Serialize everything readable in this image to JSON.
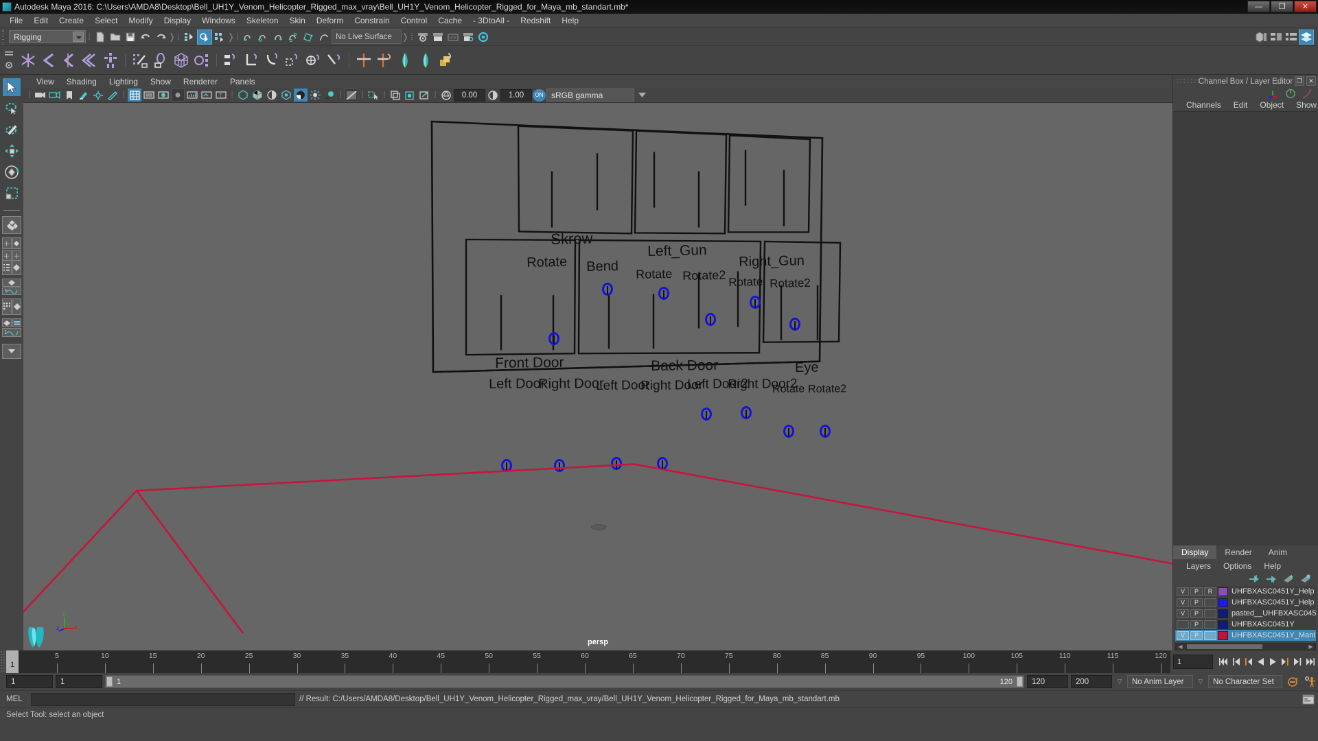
{
  "window": {
    "title": "Autodesk Maya 2016: C:\\Users\\AMDA8\\Desktop\\Bell_UH1Y_Venom_Helicopter_Rigged_max_vray\\Bell_UH1Y_Venom_Helicopter_Rigged_for_Maya_mb_standart.mb*",
    "minimize": "—",
    "maximize": "❐",
    "close": "✕"
  },
  "menubar": {
    "items": [
      "File",
      "Edit",
      "Create",
      "Select",
      "Modify",
      "Display",
      "Windows",
      "Skeleton",
      "Skin",
      "Deform",
      "Constrain",
      "Control",
      "Cache",
      "- 3DtoAll -",
      "Redshift",
      "Help"
    ]
  },
  "statusline": {
    "menuset": "Rigging",
    "live_surface": "No Live Surface"
  },
  "viewport_menu": {
    "items": [
      "View",
      "Shading",
      "Lighting",
      "Show",
      "Renderer",
      "Panels"
    ]
  },
  "viewport_toolbar": {
    "exposure": "0.00",
    "gamma": "1.00",
    "on_badge": "ON",
    "color_profile": "sRGB gamma"
  },
  "viewport": {
    "camera_label": "persp",
    "axis_x": "x",
    "axis_y": "y",
    "axis_z": "z"
  },
  "control_panel": {
    "groups": [
      {
        "title": "Skrew",
        "labels": [
          "Rotate",
          "Bend"
        ]
      },
      {
        "title": "Left_Gun",
        "labels": [
          "Rotate",
          "Rotate2"
        ]
      },
      {
        "title": "Right_Gun",
        "labels": [
          "Rotate",
          "Rotate2"
        ]
      },
      {
        "title": "Front Door",
        "labels": [
          "Left Door",
          "Right Door"
        ]
      },
      {
        "title": "Back Door",
        "labels": [
          "Left Door",
          "Right Door",
          "Left Door2",
          "Right Door2"
        ]
      },
      {
        "title": "Eye",
        "labels": [
          "Rotate",
          "Rotate2"
        ]
      }
    ]
  },
  "channel_box": {
    "panel_title": "Channel Box / Layer Editor",
    "menus": [
      "Channels",
      "Edit",
      "Object",
      "Show"
    ]
  },
  "layer_editor": {
    "tabs": [
      "Display",
      "Render",
      "Anim"
    ],
    "menus": [
      "Layers",
      "Options",
      "Help"
    ],
    "layers": [
      {
        "v": "V",
        "p": "P",
        "r": "R",
        "color": "#8a4fb5",
        "name": "UHFBXASC0451Y_Help",
        "selected": false
      },
      {
        "v": "V",
        "p": "P",
        "r": "",
        "color": "#1b1bf0",
        "name": "UHFBXASC0451Y_Help",
        "selected": false
      },
      {
        "v": "V",
        "p": "P",
        "r": "",
        "color": "#101a7e",
        "name": "pasted__UHFBXASC045",
        "selected": false
      },
      {
        "v": "",
        "p": "P",
        "r": "",
        "color": "#101a7e",
        "name": "UHFBXASC0451Y",
        "selected": false
      },
      {
        "v": "V",
        "p": "P",
        "r": "",
        "color": "#c1123c",
        "name": "UHFBXASC0451Y_Mani",
        "selected": true
      }
    ]
  },
  "timeline": {
    "ticks": [
      5,
      10,
      15,
      20,
      25,
      30,
      35,
      40,
      45,
      50,
      55,
      60,
      65,
      70,
      75,
      80,
      85,
      90,
      95,
      100,
      105,
      110,
      115,
      120
    ],
    "current_frame": "1",
    "current_frame_field": "1",
    "start_visible": "1",
    "end_visible": "120"
  },
  "range": {
    "anim_start": "1",
    "range_start": "1",
    "slider_left_label": "1",
    "slider_right_label": "120",
    "range_end": "120",
    "anim_end": "200",
    "anim_layer": "No Anim Layer",
    "character_set": "No Character Set"
  },
  "mel": {
    "label": "MEL",
    "input": "",
    "output": "// Result: C:/Users/AMDA8/Desktop/Bell_UH1Y_Venom_Helicopter_Rigged_max_vray/Bell_UH1Y_Venom_Helicopter_Rigged_for_Maya_mb_standart.mb"
  },
  "status": {
    "help_text": "Select Tool: select an object"
  }
}
